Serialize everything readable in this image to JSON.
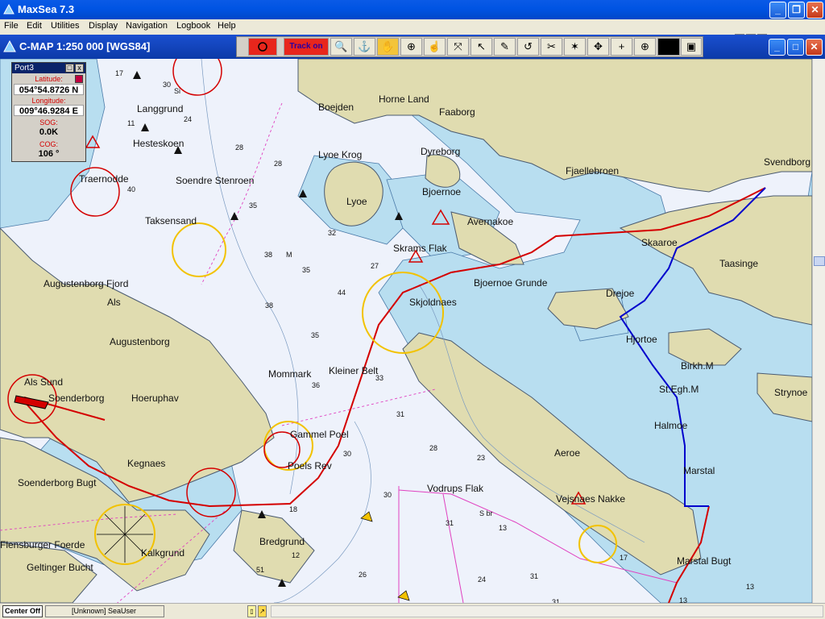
{
  "window": {
    "title": "MaxSea 7.3"
  },
  "menu": [
    "File",
    "Edit",
    "Utilities",
    "Display",
    "Navigation",
    "Logbook",
    "Help"
  ],
  "chart_header": {
    "title": "C-MAP  1:250 000 [WGS84]"
  },
  "toolbar": {
    "track_label": "Track on"
  },
  "port_panel": {
    "title": "Port3",
    "latitude_label": "Latitude:",
    "latitude_value": "054°54.8726 N",
    "longitude_label": "Longitude:",
    "longitude_value": "009°46.9284 E",
    "sog_label": "SOG:",
    "sog_value": "0.0K",
    "cog_label": "COG:",
    "cog_value": "106 °"
  },
  "status": {
    "center": "Center Off",
    "user": "[Unknown] SeaUser"
  },
  "places": [
    "Horne Land",
    "Faaborg",
    "Boejden",
    "Lyoe Krog",
    "Dyreborg",
    "Fjaellebroen",
    "Svendborg",
    "Langgrund",
    "Hesteskoen",
    "Traernodde",
    "Soendre Stenroen",
    "Lyoe",
    "Bjoernoe",
    "Avernakoe",
    "Taksensand",
    "Skaaroe",
    "Taasinge",
    "Skrams Flak",
    "Augustenborg Fjord",
    "Als",
    "Bjoernoe",
    "Drejoe",
    "Augustenborg",
    "Hjortoe",
    "Skjoldnaes",
    "Birkh.M",
    "Als Sund",
    "Mommark",
    "Kleiner Belt",
    "St.Egh.M",
    "Strynoe",
    "Soenderborg",
    "Hoeruphav",
    "Halmoe",
    "Gammel Poel",
    "Kegnaes",
    "Poels Rev",
    "Aeroe",
    "Marstal",
    "Soenderborg Bugt",
    "Vodrups Flak",
    "Vejsnaes Nakke",
    "Bredgrund",
    "Flensburger Foerde",
    "Kalkgrund",
    "Geltinger Bucht",
    "Marstal Bugt",
    "M",
    "Si"
  ],
  "colors": {
    "land": "#e0dcb0",
    "shallow": "#b8def0",
    "sea": "#eef2fb",
    "route": "#d40000",
    "route2": "#0000cc",
    "circle": "#f2c200"
  }
}
